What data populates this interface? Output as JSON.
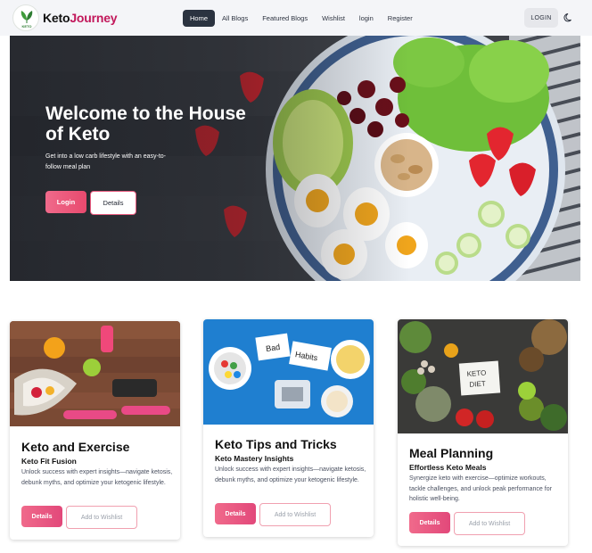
{
  "brand": {
    "name_part1": "Keto",
    "name_part2": "Journey",
    "logo_text": "KETO",
    "colors": {
      "brand_pink": "#c2185b",
      "accent_pink": "#e84a6e",
      "nav_dark": "#2b3340"
    }
  },
  "nav": {
    "links": [
      {
        "label": "Home",
        "active": true
      },
      {
        "label": "All Blogs",
        "active": false
      },
      {
        "label": "Featured Blogs",
        "active": false
      },
      {
        "label": "Wishlist",
        "active": false
      },
      {
        "label": "login",
        "active": false
      },
      {
        "label": "Register",
        "active": false
      }
    ],
    "login_button": "LOGIN",
    "theme_icon": "moon-icon"
  },
  "hero": {
    "title": "Welcome to the House of Keto",
    "subtitle": "Get into a low carb lifestyle with an easy-to-follow meal plan",
    "login_button": "Login",
    "details_button": "Details"
  },
  "cards": [
    {
      "title": "Keto and Exercise",
      "subtitle": "Keto Fit Fusion",
      "description": "Unlock success with expert insights—navigate ketosis, debunk myths, and optimize your ketogenic lifestyle.",
      "details_button": "Details",
      "wishlist_button": "Add to Wishlist"
    },
    {
      "title": "Keto Tips and Tricks",
      "subtitle": "Keto Mastery Insights",
      "description": "Unlock success with expert insights—navigate ketosis, debunk myths, and optimize your ketogenic lifestyle.",
      "details_button": "Details",
      "wishlist_button": "Add to Wishlist",
      "image_text": {
        "note1": "Bad",
        "note2": "Habits"
      }
    },
    {
      "title": "Meal Planning",
      "subtitle": "Effortless Keto Meals",
      "description": "Synergize keto with exercise—optimize workouts, tackle challenges, and unlock peak performance for holistic well-being.",
      "details_button": "Details",
      "wishlist_button": "Add to Wishlist",
      "image_text": {
        "sign_line1": "KETO",
        "sign_line2": "DIET"
      }
    }
  ]
}
